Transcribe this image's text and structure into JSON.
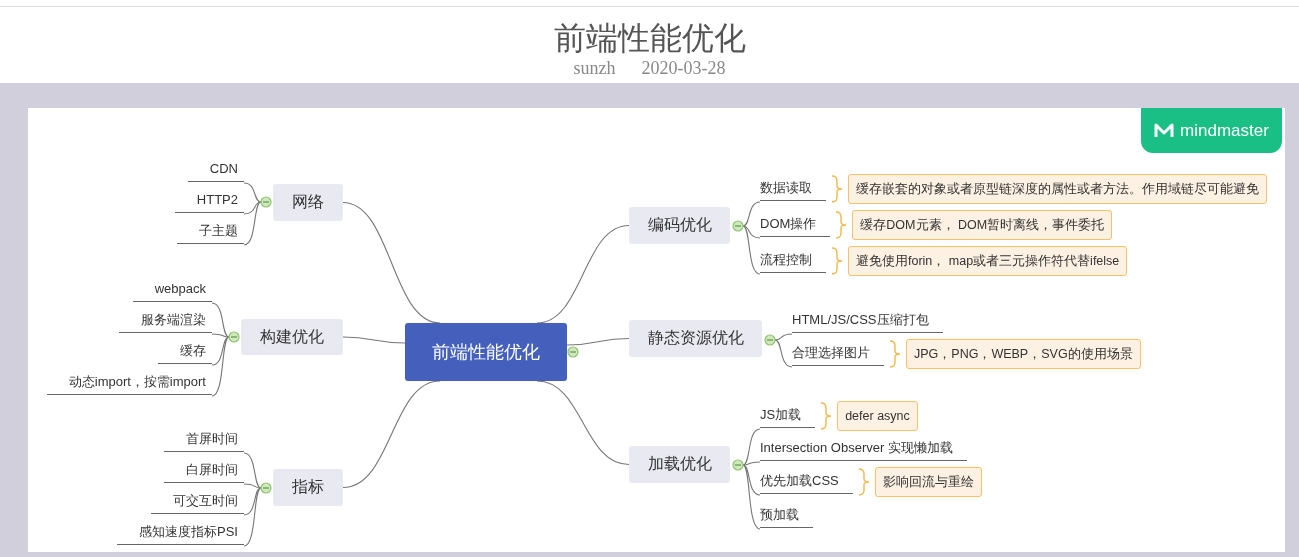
{
  "title": "前端性能优化",
  "author": "sunzh",
  "date": "2020-03-28",
  "badge": "mindmaster",
  "root": {
    "label": "前端性能优化",
    "expanded": true
  },
  "branches": [
    {
      "label": "网络",
      "expanded": true,
      "children": [
        {
          "label": "CDN"
        },
        {
          "label": "HTTP2"
        },
        {
          "label": "子主题"
        }
      ]
    },
    {
      "label": "构建优化",
      "expanded": true,
      "children": [
        {
          "label": "webpack"
        },
        {
          "label": "服务端渲染"
        },
        {
          "label": "缓存"
        },
        {
          "label": "动态import，按需import"
        }
      ]
    },
    {
      "label": "指标",
      "expanded": true,
      "children": [
        {
          "label": "首屏时间"
        },
        {
          "label": "白屏时间"
        },
        {
          "label": "可交互时间"
        },
        {
          "label": "感知速度指标PSI"
        }
      ]
    },
    {
      "label": "编码优化",
      "expanded": true,
      "children": [
        {
          "label": "数据读取",
          "note": "缓存嵌套的对象或者原型链深度的属性或者方法。作用域链尽可能避免"
        },
        {
          "label": "DOM操作",
          "note": "缓存DOM元素， DOM暂时离线，事件委托"
        },
        {
          "label": "流程控制",
          "note": "避免使用forin， map或者三元操作符代替ifelse"
        }
      ]
    },
    {
      "label": "静态资源优化",
      "expanded": true,
      "children": [
        {
          "label": "HTML/JS/CSS压缩打包"
        },
        {
          "label": "合理选择图片",
          "note": "JPG，PNG，WEBP，SVG的使用场景"
        }
      ]
    },
    {
      "label": "加载优化",
      "expanded": true,
      "children": [
        {
          "label": "JS加载",
          "note": "defer async"
        },
        {
          "label": "Intersection Observer 实现懒加载"
        },
        {
          "label": "优先加载CSS",
          "note": "影响回流与重绘"
        },
        {
          "label": "预加载"
        }
      ]
    }
  ]
}
